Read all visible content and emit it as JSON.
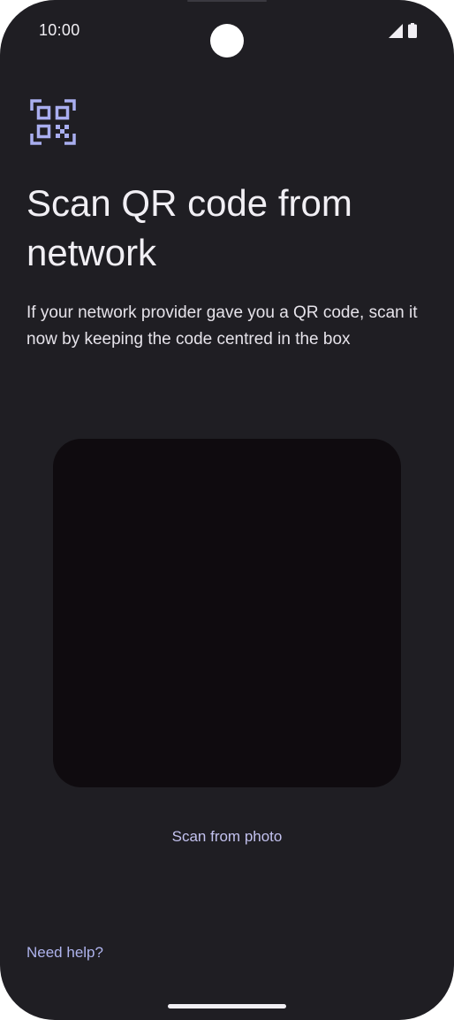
{
  "status_bar": {
    "time": "10:00",
    "icons": [
      "cellular-signal-icon",
      "battery-icon"
    ]
  },
  "header": {
    "icon": "qr-code-scan-icon",
    "title": "Scan QR code from network",
    "description": "If your network provider gave you a QR code, scan it now by keeping the code centred in the box"
  },
  "scanner": {
    "viewfinder": "camera-viewfinder"
  },
  "actions": {
    "scan_from_photo": "Scan from photo",
    "need_help": "Need help?"
  },
  "colors": {
    "background": "#1f1e23",
    "accent": "#c3c2ef",
    "icon": "#a9aef0",
    "viewfinder": "#0f0b0f"
  }
}
